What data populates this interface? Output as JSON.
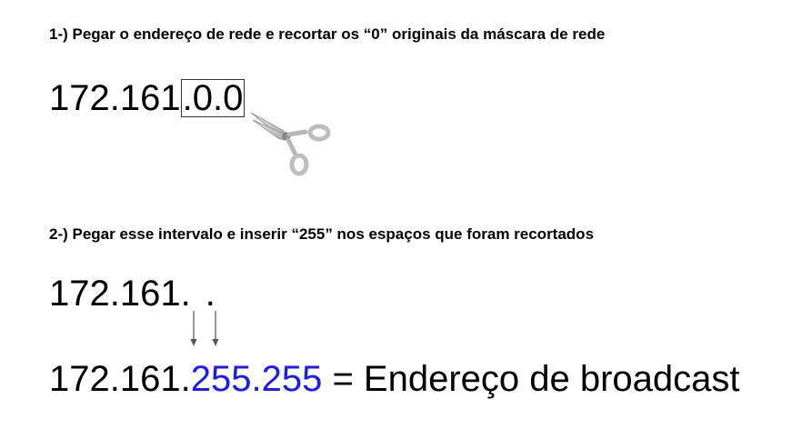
{
  "step1": {
    "title": "1-) Pegar o endereço de rede e recortar os “0” originais da máscara de rede",
    "ip_prefix": "172.161",
    "ip_cut_part": ".0.0"
  },
  "step2": {
    "title": "2-) Pegar esse intervalo e inserir “255” nos espaços que foram recortados",
    "ip_prefix": "172.161",
    "dot_a": ".",
    "dot_b": "."
  },
  "result": {
    "ip_prefix": "172.161.",
    "octet_3": "255",
    "dot": ".",
    "octet_4": "255",
    "suffix": " = Endereço de broadcast"
  },
  "colors": {
    "highlight_octets": "#1a1aff"
  },
  "icons": {
    "scissors": "scissors-icon",
    "arrow": "arrow-down-icon"
  }
}
